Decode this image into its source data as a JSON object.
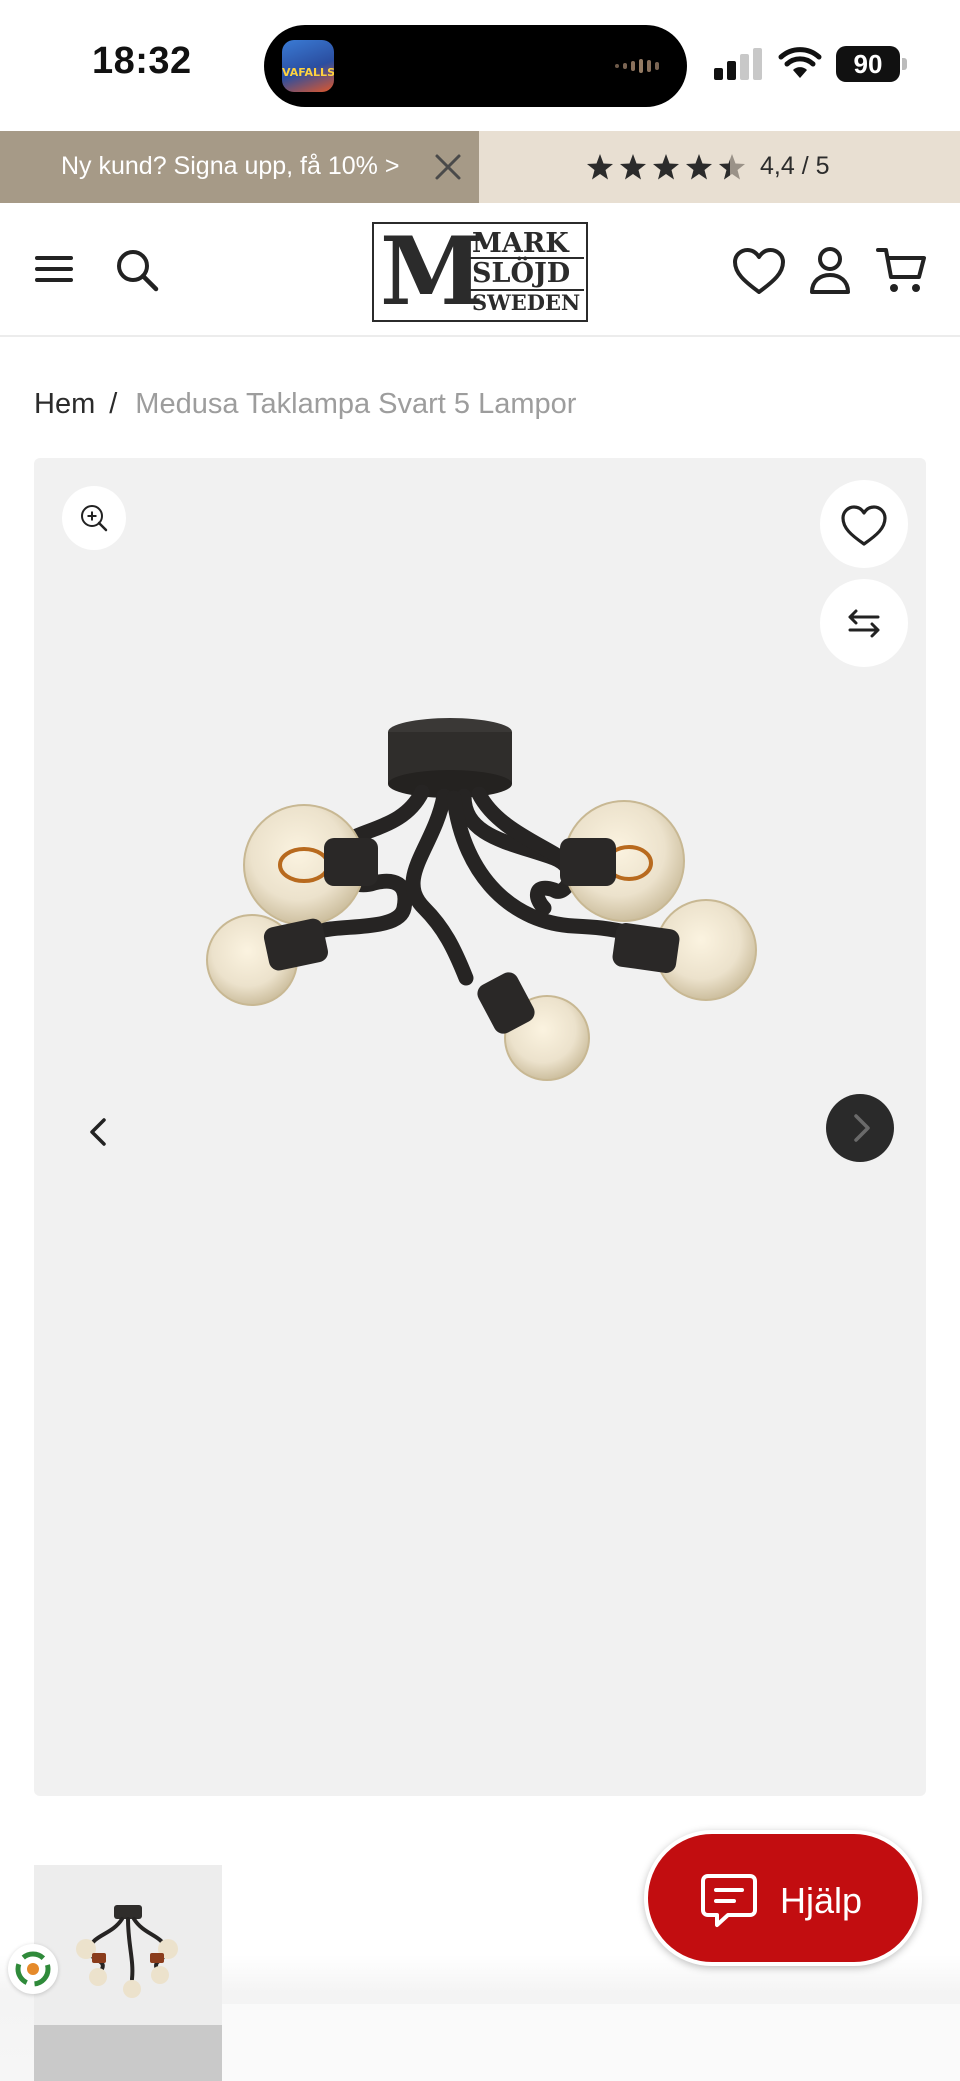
{
  "status_bar": {
    "time": "18:32",
    "battery": "90",
    "island_app_label": "VAFALLS"
  },
  "promo": {
    "text": "Ny kund? Signa upp, få 10% >",
    "rating_text": "4,4 / 5",
    "rating_value": 4.4,
    "rating_max": 5
  },
  "header": {
    "logo_letter": "M",
    "logo_line1": "MARK",
    "logo_line2": "SLÖJD",
    "logo_line3": "SWEDEN"
  },
  "breadcrumb": {
    "home": "Hem",
    "separator": "/",
    "current": "Medusa Taklampa Svart 5 Lampor"
  },
  "gallery": {
    "icons": [
      "zoom-in-icon",
      "heart-icon",
      "compare-arrows-icon",
      "chevron-left-icon",
      "chevron-right-icon"
    ]
  },
  "help": {
    "label": "Hjälp"
  },
  "colors": {
    "promo_left": "#a69a87",
    "promo_right": "#e8dfd2",
    "help_red": "#c20d10",
    "gallery_bg": "#f1f1f1",
    "breadcrumb_muted": "#9d9d9d"
  }
}
